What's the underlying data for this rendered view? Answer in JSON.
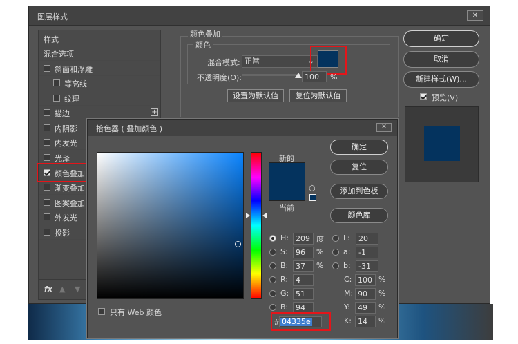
{
  "layer_style": {
    "title": "图层样式",
    "sidebar": [
      {
        "label": "样式",
        "checkbox": false
      },
      {
        "label": "混合选项",
        "checkbox": false
      },
      {
        "label": "斜面和浮雕",
        "checkbox": true,
        "checked": false
      },
      {
        "label": "等高线",
        "checkbox": true,
        "checked": false
      },
      {
        "label": "纹理",
        "checkbox": true,
        "checked": false
      },
      {
        "label": "描边",
        "checkbox": true,
        "checked": false
      },
      {
        "label": "内阴影",
        "checkbox": true,
        "checked": false
      },
      {
        "label": "内发光",
        "checkbox": true,
        "checked": false
      },
      {
        "label": "光泽",
        "checkbox": true,
        "checked": false
      },
      {
        "label": "颜色叠加",
        "checkbox": true,
        "checked": true
      },
      {
        "label": "渐变叠加",
        "checkbox": true,
        "checked": false
      },
      {
        "label": "图案叠加",
        "checkbox": true,
        "checked": false
      },
      {
        "label": "外发光",
        "checkbox": true,
        "checked": false
      },
      {
        "label": "投影",
        "checkbox": true,
        "checked": false
      }
    ],
    "fx_label": "fx",
    "section_title": "颜色叠加",
    "subsection_title": "颜色",
    "blend_mode_label": "混合模式:",
    "blend_mode_value": "正常",
    "opacity_label": "不透明度(O):",
    "opacity_value": "100",
    "opacity_unit": "%",
    "set_default": "设置为默认值",
    "reset_default": "复位为默认值",
    "ok": "确定",
    "cancel": "取消",
    "new_style": "新建样式(W)...",
    "preview_label": "预览(V)",
    "overlay_color": "#04335e"
  },
  "color_picker": {
    "title": "拾色器 ( 叠加颜色 )",
    "ok": "确定",
    "reset": "复位",
    "add_swatch": "添加到色板",
    "color_library": "颜色库",
    "new_label": "新的",
    "current_label": "当前",
    "web_only_label": "只有 Web 颜色",
    "hsb": [
      {
        "label": "H:",
        "value": "209",
        "unit": "度",
        "selected": true
      },
      {
        "label": "S:",
        "value": "96",
        "unit": "%",
        "selected": false
      },
      {
        "label": "B:",
        "value": "37",
        "unit": "%",
        "selected": false
      }
    ],
    "rgb": [
      {
        "label": "R:",
        "value": "4"
      },
      {
        "label": "G:",
        "value": "51"
      },
      {
        "label": "B:",
        "value": "94"
      }
    ],
    "lab": [
      {
        "label": "L:",
        "value": "20"
      },
      {
        "label": "a:",
        "value": "-1"
      },
      {
        "label": "b:",
        "value": "-31"
      }
    ],
    "cmyk": [
      {
        "label": "C:",
        "value": "100",
        "unit": "%"
      },
      {
        "label": "M:",
        "value": "90",
        "unit": "%"
      },
      {
        "label": "Y:",
        "value": "49",
        "unit": "%"
      },
      {
        "label": "K:",
        "value": "14",
        "unit": "%"
      }
    ],
    "hex_label": "#",
    "hex_value": "04335e",
    "new_color": "#04335e",
    "current_color": "#04335e"
  }
}
